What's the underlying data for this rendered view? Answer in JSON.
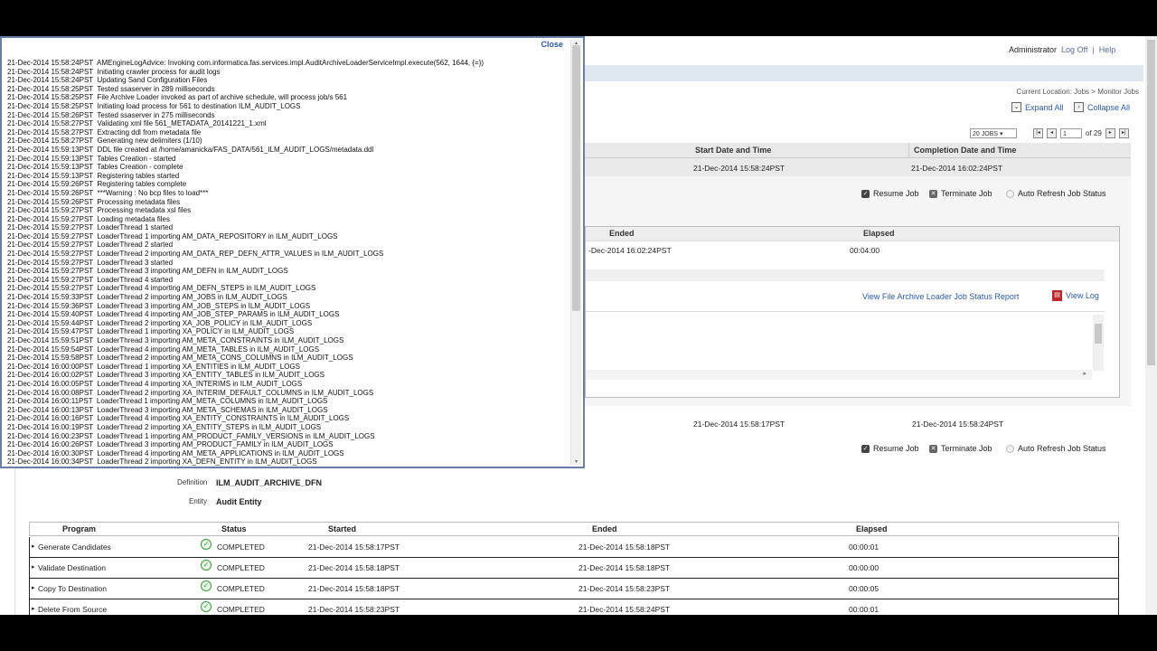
{
  "header": {
    "user": "Administrator",
    "logoff": "Log Off",
    "sep": "|",
    "help": "Help"
  },
  "breadcrumb": {
    "prefix": "Current Location:",
    "jobs": "Jobs",
    "arrow": ">",
    "current": "Monitor Jobs"
  },
  "toolbar": {
    "expand_all": "Expand All",
    "collapse_all": "Collapse All"
  },
  "pager": {
    "page_size": "20 JOBS",
    "page": "1",
    "of": "of 29"
  },
  "job_table": {
    "col_start": "Start Date and Time",
    "col_completion": "Completion Date and Time",
    "row1": {
      "start": "21-Dec-2014 15:58:24PST",
      "completion": "21-Dec-2014 16:02:24PST"
    },
    "row2": {
      "start": "21-Dec-2014 15:58:17PST",
      "completion": "21-Dec-2014 15:58:24PST"
    }
  },
  "actions": {
    "resume": "Resume Job",
    "terminate": "Terminate Job",
    "auto_refresh": "Auto Refresh Job Status"
  },
  "step_panel": {
    "col_ended": "Ended",
    "col_elapsed": "Elapsed",
    "ended": "-Dec-2014 16:02:24PST",
    "elapsed": "00:04:00",
    "report_link": "View File Archive Loader Job Status Report",
    "view_log": "View Log"
  },
  "detail": {
    "definition_label": "Definition",
    "definition": "ILM_AUDIT_ARCHIVE_DFN",
    "entity_label": "Entity",
    "entity": "Audit Entity"
  },
  "programs": {
    "headers": {
      "program": "Program",
      "status": "Status",
      "started": "Started",
      "ended": "Ended",
      "elapsed": "Elapsed"
    },
    "rows": [
      {
        "program": "Generate Candidates",
        "status": "COMPLETED",
        "started": "21-Dec-2014 15:58:17PST",
        "ended": "21-Dec-2014 15:58:18PST",
        "elapsed": "00:00:01"
      },
      {
        "program": "Validate Destination",
        "status": "COMPLETED",
        "started": "21-Dec-2014 15:58:18PST",
        "ended": "21-Dec-2014 15:58:18PST",
        "elapsed": "00:00:00"
      },
      {
        "program": "Copy To Destination",
        "status": "COMPLETED",
        "started": "21-Dec-2014 15:58:18PST",
        "ended": "21-Dec-2014 15:58:23PST",
        "elapsed": "00:00:05"
      },
      {
        "program": "Delete From Source",
        "status": "COMPLETED",
        "started": "21-Dec-2014 15:58:23PST",
        "ended": "21-Dec-2014 15:58:24PST",
        "elapsed": "00:00:01"
      }
    ]
  },
  "log_modal": {
    "close": "Close",
    "lines": [
      "21-Dec-2014 15:58:24PST  AMEngineLogAdvice: Invoking com.informatica.fas.services.impl.AuditArchiveLoaderServiceImpl.execute(562, 1644, {=})",
      "21-Dec-2014 15:58:24PST  Initiating crawler process for audit logs",
      "21-Dec-2014 15:58:24PST  Updating Sand Configuration Files",
      "21-Dec-2014 15:58:25PST  Tested ssaserver in 289 milliseconds",
      "21-Dec-2014 15:58:25PST  File Archive Loader invoked as part of archive schedule, will process job/s 561",
      "21-Dec-2014 15:58:25PST  Initiating load process for 561 to destination ILM_AUDIT_LOGS",
      "21-Dec-2014 15:58:26PST  Tested ssaserver in 275 milliseconds",
      "21-Dec-2014 15:58:27PST  Validating xml file 561_METADATA_20141221_1.xml",
      "21-Dec-2014 15:58:27PST  Extracting ddl from metadata file",
      "21-Dec-2014 15:58:27PST  Generating new delimiters (1/10)",
      "21-Dec-2014 15:59:13PST  DDL file created at /home/amanicka/FAS_DATA/561_ILM_AUDIT_LOGS/metadata.ddl",
      "21-Dec-2014 15:59:13PST  Tables Creation - started",
      "21-Dec-2014 15:59:13PST  Tables Creation - complete",
      "21-Dec-2014 15:59:13PST  Registering tables started",
      "21-Dec-2014 15:59:26PST  Registering tables complete",
      "21-Dec-2014 15:59:26PST  ***Warning : No bcp files to load***",
      "21-Dec-2014 15:59:26PST  Processing metadata files",
      "21-Dec-2014 15:59:27PST  Processing metadata xsl files",
      "21-Dec-2014 15:59:27PST  Loading metadata files",
      "21-Dec-2014 15:59:27PST  LoaderThread 1 started",
      "21-Dec-2014 15:59:27PST  LoaderThread 1 importing AM_DATA_REPOSITORY in ILM_AUDIT_LOGS",
      "21-Dec-2014 15:59:27PST  LoaderThread 2 started",
      "21-Dec-2014 15:59:27PST  LoaderThread 2 importing AM_DATA_REP_DEFN_ATTR_VALUES in ILM_AUDIT_LOGS",
      "21-Dec-2014 15:59:27PST  LoaderThread 3 started",
      "21-Dec-2014 15:59:27PST  LoaderThread 3 importing AM_DEFN in ILM_AUDIT_LOGS",
      "21-Dec-2014 15:59:27PST  LoaderThread 4 started",
      "21-Dec-2014 15:59:27PST  LoaderThread 4 importing AM_DEFN_STEPS in ILM_AUDIT_LOGS",
      "21-Dec-2014 15:59:33PST  LoaderThread 2 importing AM_JOBS in ILM_AUDIT_LOGS",
      "21-Dec-2014 15:59:36PST  LoaderThread 3 importing AM_JOB_STEPS in ILM_AUDIT_LOGS",
      "21-Dec-2014 15:59:40PST  LoaderThread 4 importing AM_JOB_STEP_PARAMS in ILM_AUDIT_LOGS",
      "21-Dec-2014 15:59:44PST  LoaderThread 2 importing XA_JOB_POLICY in ILM_AUDIT_LOGS",
      "21-Dec-2014 15:59:47PST  LoaderThread 1 importing XA_POLICY in ILM_AUDIT_LOGS",
      "21-Dec-2014 15:59:51PST  LoaderThread 3 importing AM_META_CONSTRAINTS in ILM_AUDIT_LOGS",
      "21-Dec-2014 15:59:54PST  LoaderThread 4 importing AM_META_TABLES in ILM_AUDIT_LOGS",
      "21-Dec-2014 15:59:58PST  LoaderThread 2 importing AM_META_CONS_COLUMNS in ILM_AUDIT_LOGS",
      "21-Dec-2014 16:00:00PST  LoaderThread 1 importing XA_ENTITIES in ILM_AUDIT_LOGS",
      "21-Dec-2014 16:00:02PST  LoaderThread 3 importing XA_ENTITY_TABLES in ILM_AUDIT_LOGS",
      "21-Dec-2014 16:00:05PST  LoaderThread 4 importing XA_INTERIMS in ILM_AUDIT_LOGS",
      "21-Dec-2014 16:00:08PST  LoaderThread 2 importing XA_INTERIM_DEFAULT_COLUMNS in ILM_AUDIT_LOGS",
      "21-Dec-2014 16:00:11PST  LoaderThread 1 importing AM_META_COLUMNS in ILM_AUDIT_LOGS",
      "21-Dec-2014 16:00:13PST  LoaderThread 3 importing AM_META_SCHEMAS in ILM_AUDIT_LOGS",
      "21-Dec-2014 16:00:16PST  LoaderThread 4 importing XA_ENTITY_CONSTRAINTS in ILM_AUDIT_LOGS",
      "21-Dec-2014 16:00:19PST  LoaderThread 2 importing XA_ENTITY_STEPS in ILM_AUDIT_LOGS",
      "21-Dec-2014 16:00:23PST  LoaderThread 1 importing AM_PRODUCT_FAMILY_VERSIONS in ILM_AUDIT_LOGS",
      "21-Dec-2014 16:00:26PST  LoaderThread 3 importing AM_PRODUCT_FAMILY in ILM_AUDIT_LOGS",
      "21-Dec-2014 16:00:30PST  LoaderThread 4 importing AM_META_APPLICATIONS in ILM_AUDIT_LOGS",
      "21-Dec-2014 16:00:34PST  LoaderThread 2 importing XA_DEFN_ENTITY in ILM_AUDIT_LOGS"
    ]
  }
}
